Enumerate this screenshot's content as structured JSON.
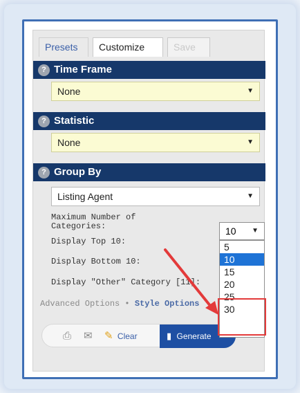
{
  "tabs": {
    "presets": "Presets",
    "customize": "Customize",
    "save": "Save"
  },
  "sections": {
    "time_frame": {
      "title": "Time Frame",
      "value": "None"
    },
    "statistic": {
      "title": "Statistic",
      "value": "None"
    },
    "group_by": {
      "title": "Group By",
      "value": "Listing Agent"
    }
  },
  "options": {
    "max_categories_label": "Maximum Number of\nCategories:",
    "max_categories_value": "10",
    "display_top_label": "Display Top 10:",
    "display_bottom_label": "Display Bottom 10:",
    "display_other_label": "Display \"Other\" Category [11]:"
  },
  "dropdown_options": [
    "5",
    "10",
    "15",
    "20",
    "25",
    "30"
  ],
  "selected_option": "10",
  "links": {
    "advanced": "Advanced Options",
    "separator": "•",
    "style": "Style Options"
  },
  "toolbar": {
    "clear": "Clear",
    "generate": "Generate"
  },
  "icons": {
    "help": "question-icon",
    "print": "print-icon",
    "email": "mail-icon",
    "clear": "brush-icon",
    "generate": "chart-icon",
    "dropdown": "chevron-down-icon"
  },
  "colors": {
    "section_header": "#16386a",
    "select_highlight": "#fbfbd3",
    "selected_option": "#1e73d6",
    "annotation": "#e33a3a",
    "generate_button": "#1e4fa3"
  }
}
